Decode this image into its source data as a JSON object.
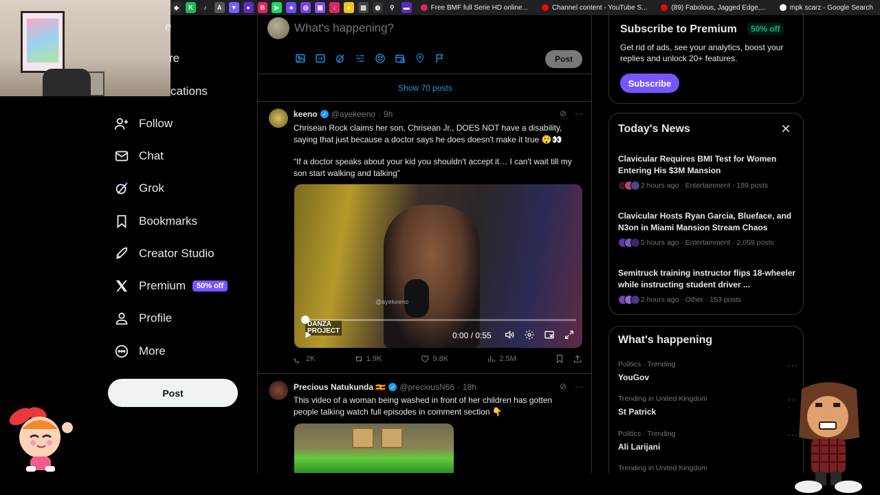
{
  "browser": {
    "tabs": [
      {
        "title": "Free BMF full Serie HD online...",
        "color": "#e0245e"
      },
      {
        "title": "Channel content - YouTube S...",
        "color": "#ff0000"
      },
      {
        "title": "(89) Fabolous, Jagged Edge,...",
        "color": "#ff0000"
      },
      {
        "title": "mpk scarz - Google Search",
        "color": "#ffffff"
      }
    ]
  },
  "nav": {
    "partial_top_1": "e",
    "partial_top_2": "re",
    "partial_notifications": "cations",
    "items": [
      {
        "label": "Follow",
        "icon": "follow-icon"
      },
      {
        "label": "Chat",
        "icon": "mail-icon"
      },
      {
        "label": "Grok",
        "icon": "grok-icon"
      },
      {
        "label": "Bookmarks",
        "icon": "bookmark-icon"
      },
      {
        "label": "Creator Studio",
        "icon": "rocket-icon"
      },
      {
        "label": "Premium",
        "icon": "x-logo-icon",
        "badge": "50% off"
      },
      {
        "label": "Profile",
        "icon": "profile-icon"
      },
      {
        "label": "More",
        "icon": "more-circle-icon"
      }
    ],
    "post_button": "Post"
  },
  "compose": {
    "placeholder": "What's happening?",
    "post_button": "Post"
  },
  "feed": {
    "show_posts": "Show 70 posts",
    "tweet1": {
      "name": "keeno",
      "handle": "@ayekeeno",
      "time": "9h",
      "text1": "Chrisean Rock claims her son, Chrisean Jr., DOES NOT have a disability, saying that just because a doctor says he does doesn't make it true 😲👀",
      "text2": "“If a doctor speaks about your kid you shouldn't accept it… I can't wait till my son start walking and talking”",
      "video": {
        "watermark": "@ayekeeno",
        "brand_line1": "DANZA",
        "brand_line2": "PROJECT",
        "time": "0:00 / 0:55",
        "progress": 0
      },
      "stats": {
        "replies": "2K",
        "reposts": "1.9K",
        "likes": "9.8K",
        "views": "2.5M"
      }
    },
    "tweet2": {
      "name": "Precious Natukunda 🇺🇬",
      "handle": "@preciousN66",
      "time": "18h",
      "text": "This video of a woman being washed in front of her children has gotten people talking watch full episodes in comment section 👇"
    }
  },
  "premium": {
    "title": "Subscribe to Premium",
    "badge": "50% off",
    "desc": "Get rid of ads, see your analytics, boost your replies and unlock 20+ features.",
    "button": "Subscribe"
  },
  "news": {
    "title": "Today's News",
    "items": [
      {
        "title": "Clavicular Requires BMI Test for Women Entering His $3M Mansion",
        "meta": "2 hours ago · Entertainment · 189 posts"
      },
      {
        "title": "Clavicular Hosts Ryan Garcia, Blueface, and N3on in Miami Mansion Stream Chaos",
        "meta": "5 hours ago · Entertainment · 2,059 posts"
      },
      {
        "title": "Semitruck training instructor flips 18-wheeler while instructing student driver ...",
        "meta": "2 hours ago · Other · 153 posts"
      }
    ]
  },
  "happening": {
    "title": "What's happening",
    "trends": [
      {
        "context": "Politics · Trending",
        "name": "YouGov"
      },
      {
        "context": "Trending in United Kingdom",
        "name": "St Patrick"
      },
      {
        "context": "Politics · Trending",
        "name": "Ali Larijani"
      },
      {
        "context": "Trending in United Kingdom",
        "name": ""
      }
    ]
  }
}
